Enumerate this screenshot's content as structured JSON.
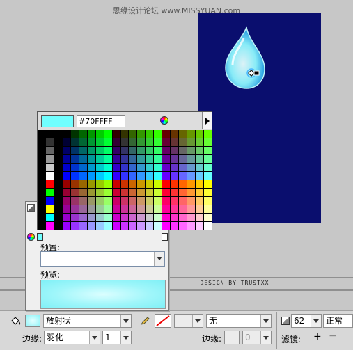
{
  "watermark": "思缘设计论坛 www.MISSYUAN.com",
  "credit": "DESIGN BY TRUSTXX",
  "color_picker": {
    "current_hex": "#70FFFF",
    "swatch_color": "#70ffff",
    "grays": [
      "#000000",
      "#333333",
      "#666666",
      "#999999",
      "#cccccc",
      "#ffffff"
    ],
    "primaries": [
      "#ff0000",
      "#00ff00",
      "#0000ff",
      "#ffff00",
      "#00ffff",
      "#ff00ff"
    ]
  },
  "gradient_panel": {
    "preset_label": "预置:",
    "preset_value": "",
    "preview_label": "预览:"
  },
  "properties": {
    "fill_type": "放射状",
    "stroke_style": "无",
    "edge_label": "边缘:",
    "edge_value": "羽化",
    "edge_amount": "1",
    "stroke_edge_label": "边缘:",
    "stroke_edge_amount": "0",
    "opacity": "62",
    "blend_mode": "正常",
    "filters_label": "滤镜:"
  }
}
